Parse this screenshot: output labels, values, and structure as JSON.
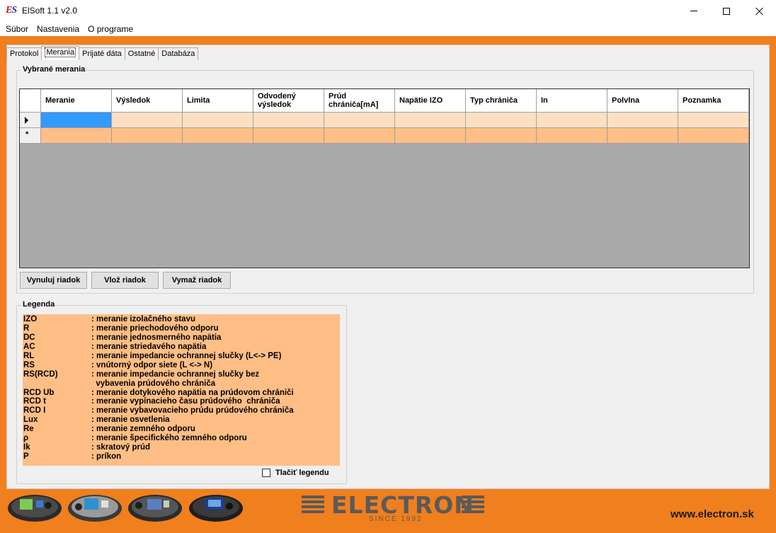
{
  "window": {
    "title": "ElSoft 1.1 v2.0"
  },
  "menu": [
    "Súbor",
    "Nastavenia",
    "O programe"
  ],
  "tabs": [
    "Protokol",
    "Merania",
    "Prijaté dáta",
    "Ostatné",
    "Databáza"
  ],
  "active_tab": "Merania",
  "measurements": {
    "group_title": "Vybrané merania",
    "columns": [
      "Meranie",
      "Výsledok",
      "Limita",
      "Odvodený výsledok",
      "Prúd chrániča[mA]",
      "Napätie IZO",
      "Typ chrániča",
      "In",
      "Polvlna",
      "Poznamka"
    ],
    "new_row_marker": "*",
    "buttons": {
      "reset_row": "Vynuluj riadok",
      "insert_row": "Vlož riadok",
      "delete_row": "Vymaž riadok"
    }
  },
  "legend": {
    "group_title": "Legenda",
    "items": [
      {
        "code": "IZO",
        "desc": ": meranie izolačného stavu"
      },
      {
        "code": "R",
        "desc": ": meranie priechodového odporu"
      },
      {
        "code": "DC",
        "desc": ": meranie jednosmerného napätia"
      },
      {
        "code": "AC",
        "desc": ": meranie striedavého napätia"
      },
      {
        "code": "RL",
        "desc": ": meranie impedancie ochrannej slučky (L<-> PE)"
      },
      {
        "code": "RS",
        "desc": ": vnútorný odpor siete (L <-> N)"
      },
      {
        "code": "RS(RCD)",
        "desc": ": meranie impedancie ochrannej slučky bez"
      },
      {
        "code": "",
        "desc": "  vybavenia prúdového chrániča"
      },
      {
        "code": "RCD Ub",
        "desc": ": meranie dotykového napätia na prúdovom chrániči"
      },
      {
        "code": "RCD t",
        "desc": ": meranie vypínacieho času prúdového  chrániča"
      },
      {
        "code": "RCD I",
        "desc": ": meranie vybavovacieho prúdu prúdového chrániča"
      },
      {
        "code": "Lux",
        "desc": ": meranie osvetlenia"
      },
      {
        "code": "Re",
        "desc": ": meranie zemného odporu"
      },
      {
        "code": "ρ",
        "desc": ": meranie špecifického zemného odporu"
      },
      {
        "code": "Ik",
        "desc": ": skratový prúd"
      },
      {
        "code": "P",
        "desc": ": príkon"
      }
    ],
    "print_legend_label": "Tlačiť legendu",
    "print_legend_checked": false
  },
  "footer": {
    "brand": "ELECTRON",
    "since": "SINCE 1992",
    "website": "www.electron.sk"
  },
  "colors": {
    "accent_orange": "#f07f1e",
    "row_selected": "#3399ff",
    "row_light": "#fde0c4",
    "row_orange": "#ffbf86",
    "legend_bg": "#ffbe86"
  }
}
